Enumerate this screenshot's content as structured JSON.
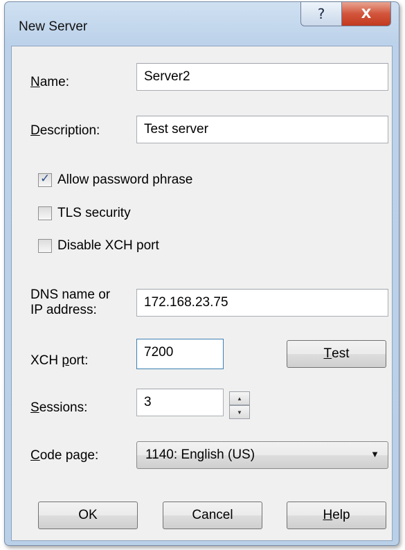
{
  "window": {
    "title": "New Server",
    "help_button": "?",
    "close_button": "X"
  },
  "form": {
    "name": {
      "label_accel": "N",
      "label_rest": "ame:",
      "value": "Server2"
    },
    "description": {
      "label_accel": "D",
      "label_rest": "escription:",
      "value": "Test server"
    },
    "checkboxes": [
      {
        "label": "Allow password phrase",
        "checked": true
      },
      {
        "label": "TLS security",
        "checked": false
      },
      {
        "label": "Disable XCH port",
        "checked": false
      }
    ],
    "dns": {
      "label_line1": "DNS name or",
      "label_line2": "IP address:",
      "value": "172.168.23.75"
    },
    "xch_port": {
      "label_pre": "XCH ",
      "label_accel": "p",
      "label_rest": "ort:",
      "value": "7200"
    },
    "test_button": {
      "accel": "T",
      "rest": "est"
    },
    "sessions": {
      "label_accel": "S",
      "label_rest": "essions:",
      "value": "3"
    },
    "code_page": {
      "label_accel": "C",
      "label_rest": "ode page:",
      "value": "1140: English (US)"
    }
  },
  "buttons": {
    "ok": "OK",
    "cancel": "Cancel",
    "help_accel": "H",
    "help_rest": "elp"
  },
  "icons": {
    "checkmark": "✓",
    "spin_up": "▲",
    "spin_down": "▼",
    "dropdown": "▼"
  }
}
